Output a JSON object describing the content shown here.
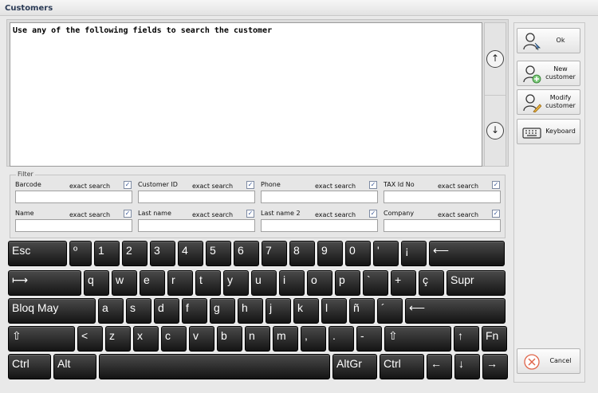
{
  "window": {
    "title": "Customers"
  },
  "message": {
    "text": "Use any of the following fields to search the customer"
  },
  "scroll": {
    "up_glyph": "↑",
    "down_glyph": "↓"
  },
  "filter": {
    "legend": "Filter",
    "exact_label": "exact search",
    "check_glyph": "✓",
    "fields": [
      {
        "label": "Barcode",
        "value": "",
        "exact": true
      },
      {
        "label": "Customer ID",
        "value": "",
        "exact": true
      },
      {
        "label": "Phone",
        "value": "",
        "exact": true
      },
      {
        "label": "TAX Id No",
        "value": "",
        "exact": true
      },
      {
        "label": "Name",
        "value": "",
        "exact": true
      },
      {
        "label": "Last name",
        "value": "",
        "exact": true
      },
      {
        "label": "Last name 2",
        "value": "",
        "exact": true
      },
      {
        "label": "Company",
        "value": "",
        "exact": true
      }
    ]
  },
  "keyboard": {
    "rows": [
      [
        "Esc",
        "º",
        "1",
        "2",
        "3",
        "4",
        "5",
        "6",
        "7",
        "8",
        "9",
        "0",
        "'",
        "¡",
        "⟵"
      ],
      [
        "⟼",
        "q",
        "w",
        "e",
        "r",
        "t",
        "y",
        "u",
        "i",
        "o",
        "p",
        "`",
        "+",
        "ç",
        "Supr"
      ],
      [
        "Bloq May",
        "a",
        "s",
        "d",
        "f",
        "g",
        "h",
        "j",
        "k",
        "l",
        "ñ",
        "´",
        "⟵"
      ],
      [
        "⇧",
        "<",
        "z",
        "x",
        "c",
        "v",
        "b",
        "n",
        "m",
        ",",
        ".",
        "-",
        "⇧",
        "↑",
        "Fn"
      ],
      [
        "Ctrl",
        "Alt",
        " ",
        "AltGr",
        "Ctrl",
        "←",
        "↓",
        "→"
      ]
    ]
  },
  "side_buttons": {
    "ok": {
      "label": "Ok",
      "icon": "user-select-icon"
    },
    "new_customer": {
      "label": "New customer",
      "icon": "user-add-icon"
    },
    "modify_customer": {
      "label": "Modify customer",
      "icon": "user-edit-icon"
    },
    "keyboard": {
      "label": "Keyboard",
      "icon": "keyboard-icon"
    },
    "cancel": {
      "label": "Cancel",
      "icon": "cancel-icon"
    }
  }
}
